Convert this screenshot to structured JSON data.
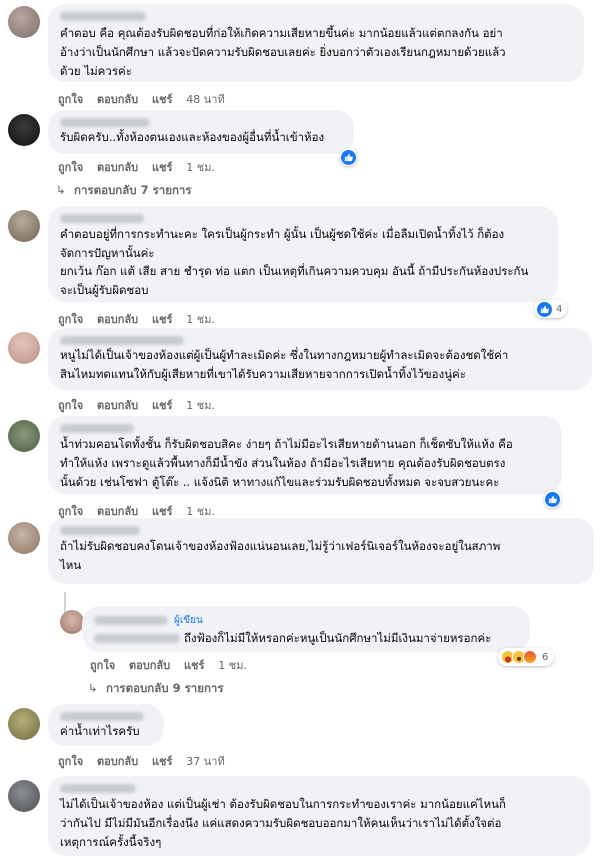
{
  "labels": {
    "like": "ถูกใจ",
    "reply": "ตอบกลับ",
    "share": "แชร์"
  },
  "comments": [
    {
      "text": "คำตอบ คือ คุณต้องรับผิดชอบที่ก่อให้เกิดความเสียหายขึ้นค่ะ มากน้อยแล้วแต่ตกลงกัน อย่า\nอ้างว่าเป็นนักศึกษา แล้วจะปัดความรับผิดชอบเลยค่ะ ยิ่งบอกว่าตัวเองเรียนกฎหมายด้วยแล้ว\nด้วย ไม่ควรค่ะ",
      "time": "48 นาที"
    },
    {
      "text": "รับผิดครับ..ทั้งห้องตนเองและห้องของผู้อื่นที่น้ำเข้าห้อง",
      "time": "1 ชม.",
      "replies_link": "การตอบกลับ 7 รายการ"
    },
    {
      "text": "คำตอบอยู่ที่การกระทำนะคะ ใครเป็นผู้กระทำ ผู้นั้น เป็นผู้ชดใช้ค่ะ เมื่อลืมเปิดน้ำทิ้งไว้ ก็ต้อง\nจัดการปัญหานั้นค่ะ\nยกเว้น ก๊อก แต้ เสีย สาย ชำรุด ท่อ แตก เป็นเหตุที่เกินความควบคุม อันนี้ ถ้ามีประกันห้องประกัน\nจะเป็นผู้รับผิดชอบ",
      "time": "1 ชม.",
      "reaction_count": "4"
    },
    {
      "text": "หนูไม่ได้เป็นเจ้าของห้องแต่ผู้เป็นผู้ทำละเมิดค่ะ ซึ่งในทางกฎหมายผู้ทำละเมิดจะต้องชดใช้ค่า\nสินไหมทดแทนให้กับผู้เสียหายที่เขาได้รับความเสียหายจากการเปิดน้ำทิ้งไว้ของนู่ค่ะ",
      "time": "1 ชม."
    },
    {
      "text": "น้ำท่วมคอนโดทั้งชั้น ก็รับผิดชอบสิคะ ง่ายๆ ถ้าไม่มีอะไรเสียหายด้านนอก ก็เช็ดซับให้แห้ง คือ\nทำให้แห้ง เพราะดูแล้วพื้นทางก็มีน้ำขัง ส่วนในห้อง ถ้ามีอะไรเสียหาย คุณต้องรับผิดชอบตรง\nนั้นด้วย เช่นโซฟา ตู้โต๊ะ .. แจ้งนิติ หาทางแก้ไขและร่วมรับผิดชอบทั้งหมด จะจบสวยนะคะ",
      "time": "1 ชม."
    },
    {
      "text": "ถ้าไม่รับผิดชอบคงโดนเจ้าของห้องฟ้องแน่นอนเลย,ไม่รู้ว่าเฟอร์นิเจอร์ในห้องจะอยู่ในสภาพ\nไหน",
      "time": "",
      "replies_link": "การตอบกลับ 9 รายการ"
    },
    {
      "text": "ค่าน้ำเท่าไรครับ",
      "time": "37 นาที"
    },
    {
      "text": "ไม่ได้เป็นเจ้าของห้อง แต่เป็นผู้เช่า ต้องรับผิดชอบในการกระทำของเราค่ะ มากน้อยแค่ไหนก็\nว่ากันไป มีไม่มีมันอีกเรื่องนึง แค่แสดงความรับผิดชอบออกมาให้คนเห็นว่าเราไม่ได้ตั้งใจต่อ\nเหตุการณ์ครั้งนี้จริงๆ",
      "time": ""
    }
  ],
  "nested_reply": {
    "badge": "ผู้เขียน",
    "text": "ถึงฟ้องก็ไม่มีให้หรอกค่ะหนูเป็นนักศึกษาไม่มีเงินมาจ่ายหรอกค่ะ",
    "time": "1 ชม.",
    "reaction_count": "6"
  },
  "colors": {
    "bubble": "#f0f2f5",
    "meta": "#65676b",
    "accent": "#1877f2",
    "line": "#ced0d4"
  }
}
